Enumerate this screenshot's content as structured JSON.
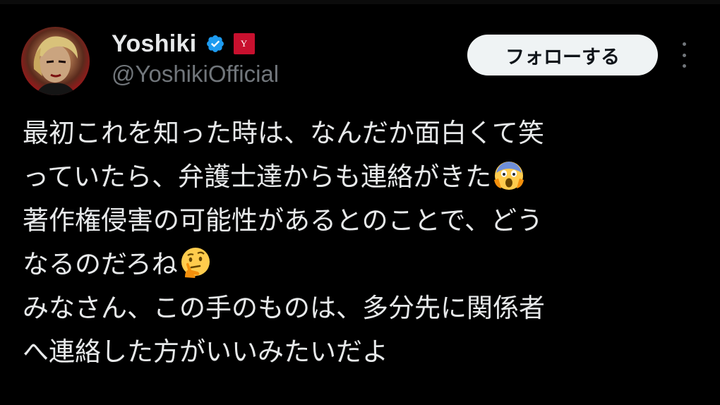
{
  "user": {
    "display_name": "Yoshiki",
    "handle": "@YoshikiOfficial",
    "verified": true,
    "badge_icon": "brand-affiliate-badge",
    "badge_color": "#c8102e",
    "badge_glyph": "Y"
  },
  "actions": {
    "follow_label": "フォローする",
    "more_icon": "more-vertical-icon"
  },
  "tweet": {
    "lines": [
      {
        "text": "最初これを知った時は、なんだか面白くて笑",
        "emoji": null
      },
      {
        "text": "っていたら、弁護士達からも連絡がきた",
        "emoji": "face-screaming-in-fear-emoji"
      },
      {
        "text": "著作権侵害の可能性があるとのことで、どう",
        "emoji": null
      },
      {
        "text": "なるのだろね",
        "emoji": "thinking-face-emoji"
      },
      {
        "text": "みなさん、この手のものは、多分先に関係者",
        "emoji": null
      },
      {
        "text": "へ連絡した方がいいみたいだよ",
        "emoji": null
      }
    ]
  },
  "colors": {
    "background": "#000000",
    "text_primary": "#e7e9ea",
    "text_secondary": "#71767b",
    "verified_blue": "#1d9bf0",
    "button_bg": "#eff3f4"
  }
}
